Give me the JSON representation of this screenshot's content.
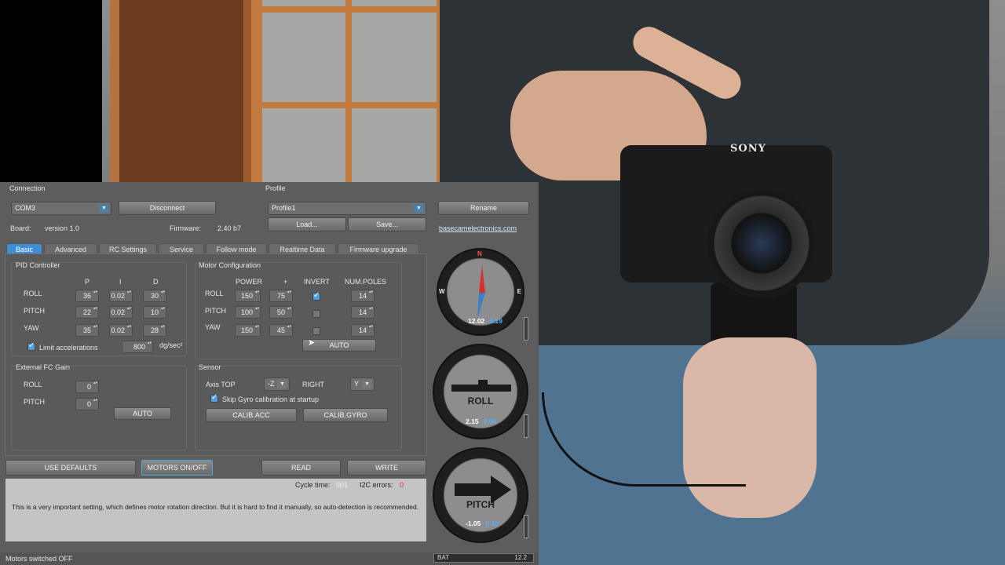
{
  "camera_brand": "SONY",
  "connection": {
    "section_label": "Connection",
    "port": "COM3",
    "disconnect_label": "Disconnect",
    "board_label": "Board:",
    "board_version": "version 1.0",
    "firmware_label": "Firmware:",
    "firmware_version": "2.40 b7"
  },
  "profile": {
    "section_label": "Profile",
    "current": "Profile1",
    "rename_label": "Rename",
    "load_label": "Load...",
    "save_label": "Save...",
    "website": "basecamelectronics.com"
  },
  "tabs": [
    "Basic",
    "Advanced",
    "RC Settings",
    "Service",
    "Follow mode",
    "Realtime Data",
    "Firmware upgrade"
  ],
  "pid": {
    "title": "PID Controller",
    "headers": [
      "P",
      "I",
      "D"
    ],
    "rows": [
      {
        "axis": "ROLL",
        "p": "36",
        "i": "0.02",
        "d": "30"
      },
      {
        "axis": "PITCH",
        "p": "22",
        "i": "0.02",
        "d": "10"
      },
      {
        "axis": "YAW",
        "p": "35",
        "i": "0.02",
        "d": "28"
      }
    ],
    "limit_label": "Limit accelerations",
    "limit_value": "800",
    "limit_unit": "dg/sec²"
  },
  "motor": {
    "title": "Motor Configuration",
    "headers": [
      "POWER",
      "+",
      "INVERT",
      "NUM.POLES"
    ],
    "rows": [
      {
        "axis": "ROLL",
        "power": "150",
        "plus": "75",
        "invert": true,
        "poles": "14"
      },
      {
        "axis": "PITCH",
        "power": "100",
        "plus": "50",
        "invert": false,
        "poles": "14"
      },
      {
        "axis": "YAW",
        "power": "150",
        "plus": "45",
        "invert": false,
        "poles": "14"
      }
    ],
    "auto_label": "AUTO"
  },
  "ext_fc": {
    "title": "External FC Gain",
    "rows": [
      {
        "axis": "ROLL",
        "value": "0"
      },
      {
        "axis": "PITCH",
        "value": "0"
      }
    ],
    "auto_label": "AUTO"
  },
  "sensor": {
    "title": "Sensor",
    "axis_top_label": "Axis TOP",
    "axis_top_value": "-Z",
    "right_label": "RIGHT",
    "right_value": "Y",
    "skip_gyro_label": "Skip Gyro calibration at startup",
    "calib_acc_label": "CALIB.ACC",
    "calib_gyro_label": "CALIB.GYRO"
  },
  "buttons": {
    "use_defaults": "USE DEFAULTS",
    "motors_onoff": "MOTORS ON/OFF",
    "read": "READ",
    "write": "WRITE"
  },
  "stats": {
    "cycle_time_label": "Cycle time:",
    "cycle_time_value": "901",
    "i2c_label": "I2C errors:",
    "i2c_value": "0"
  },
  "info_text": "This is a very important setting, which defines motor rotation direction. But it is hard to find it manually, so auto-detection is recommended.",
  "status_text": "Motors switched OFF",
  "battery": {
    "label": "BAT",
    "value": "12.2"
  },
  "gauges": {
    "compass": {
      "n": "N",
      "w": "W",
      "e": "E",
      "value": "12.02",
      "rate": "0.19"
    },
    "roll": {
      "title": "ROLL",
      "value": "2.15",
      "rate": "0.04"
    },
    "pitch": {
      "title": "PITCH",
      "value": "-1.05",
      "rate": "0.10"
    }
  },
  "colors": {
    "accent": "#3f8fd6",
    "panel": "#5d5d5d",
    "error": "#e03030"
  }
}
